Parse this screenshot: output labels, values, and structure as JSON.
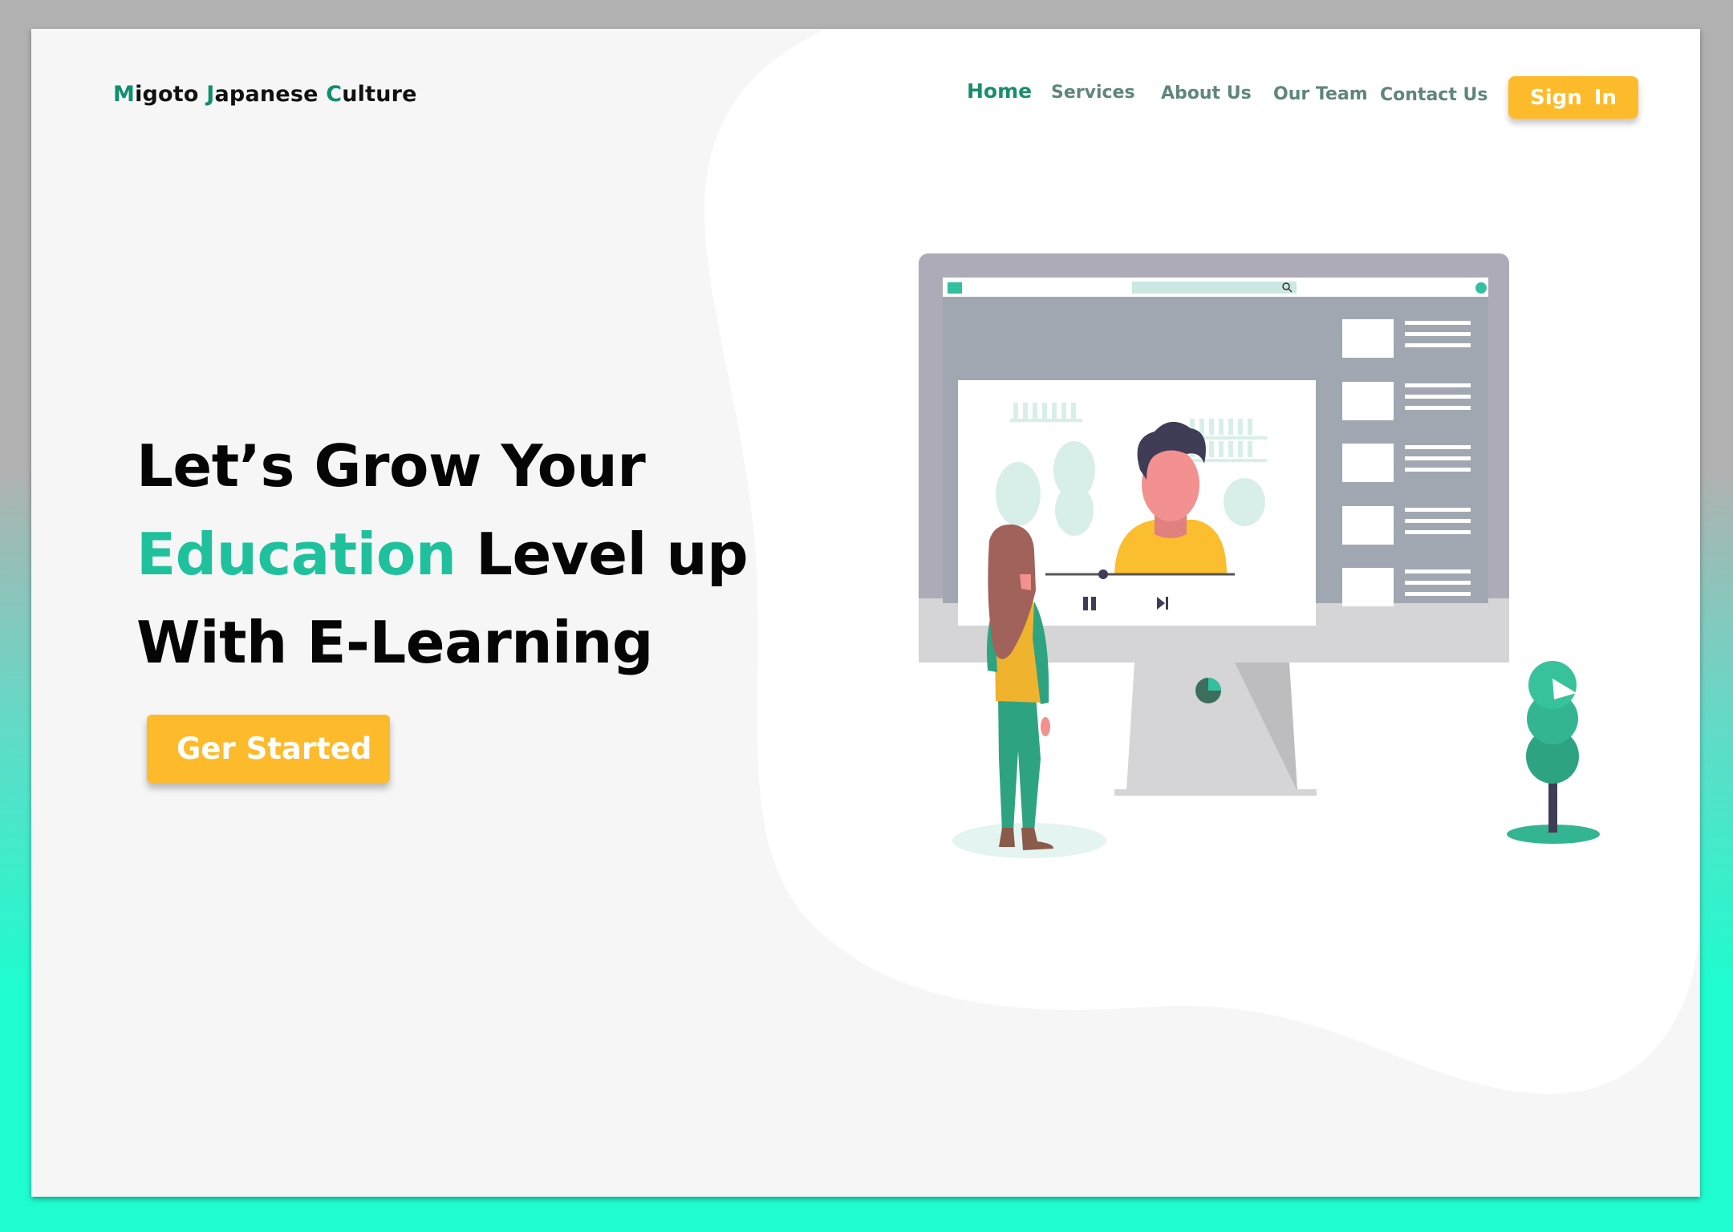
{
  "brand": {
    "parts": [
      {
        "initial": "M",
        "rest": "igoto "
      },
      {
        "initial": "J",
        "rest": "apanese "
      },
      {
        "initial": "C",
        "rest": "ulture"
      }
    ]
  },
  "nav": {
    "items": [
      {
        "label": "Home",
        "active": true
      },
      {
        "label": "Services",
        "active": false
      },
      {
        "label": "About Us",
        "active": false
      },
      {
        "label": "Our Team",
        "active": false
      },
      {
        "label": "Contact Us",
        "active": false
      }
    ],
    "signin_label": "Sign  In"
  },
  "hero": {
    "line1": "Let’s Grow Your",
    "line2_accent": "Education",
    "line2_rest": " Level up",
    "line3": "With E-Learning",
    "cta_label": "Ger Started"
  },
  "colors": {
    "accent": "#1fc19d",
    "cta": "#fdbb2c",
    "nav_active": "#1a8e6c",
    "nav_text": "#5f857c",
    "background_top": "#b1b1b1",
    "background_bottom": "#1ffcd0"
  },
  "illustration": {
    "icons": [
      "monitor-icon",
      "video-player-icon",
      "search-icon",
      "skip-back-icon",
      "pause-icon",
      "skip-forward-icon",
      "woman-figure",
      "plant-icon"
    ]
  }
}
